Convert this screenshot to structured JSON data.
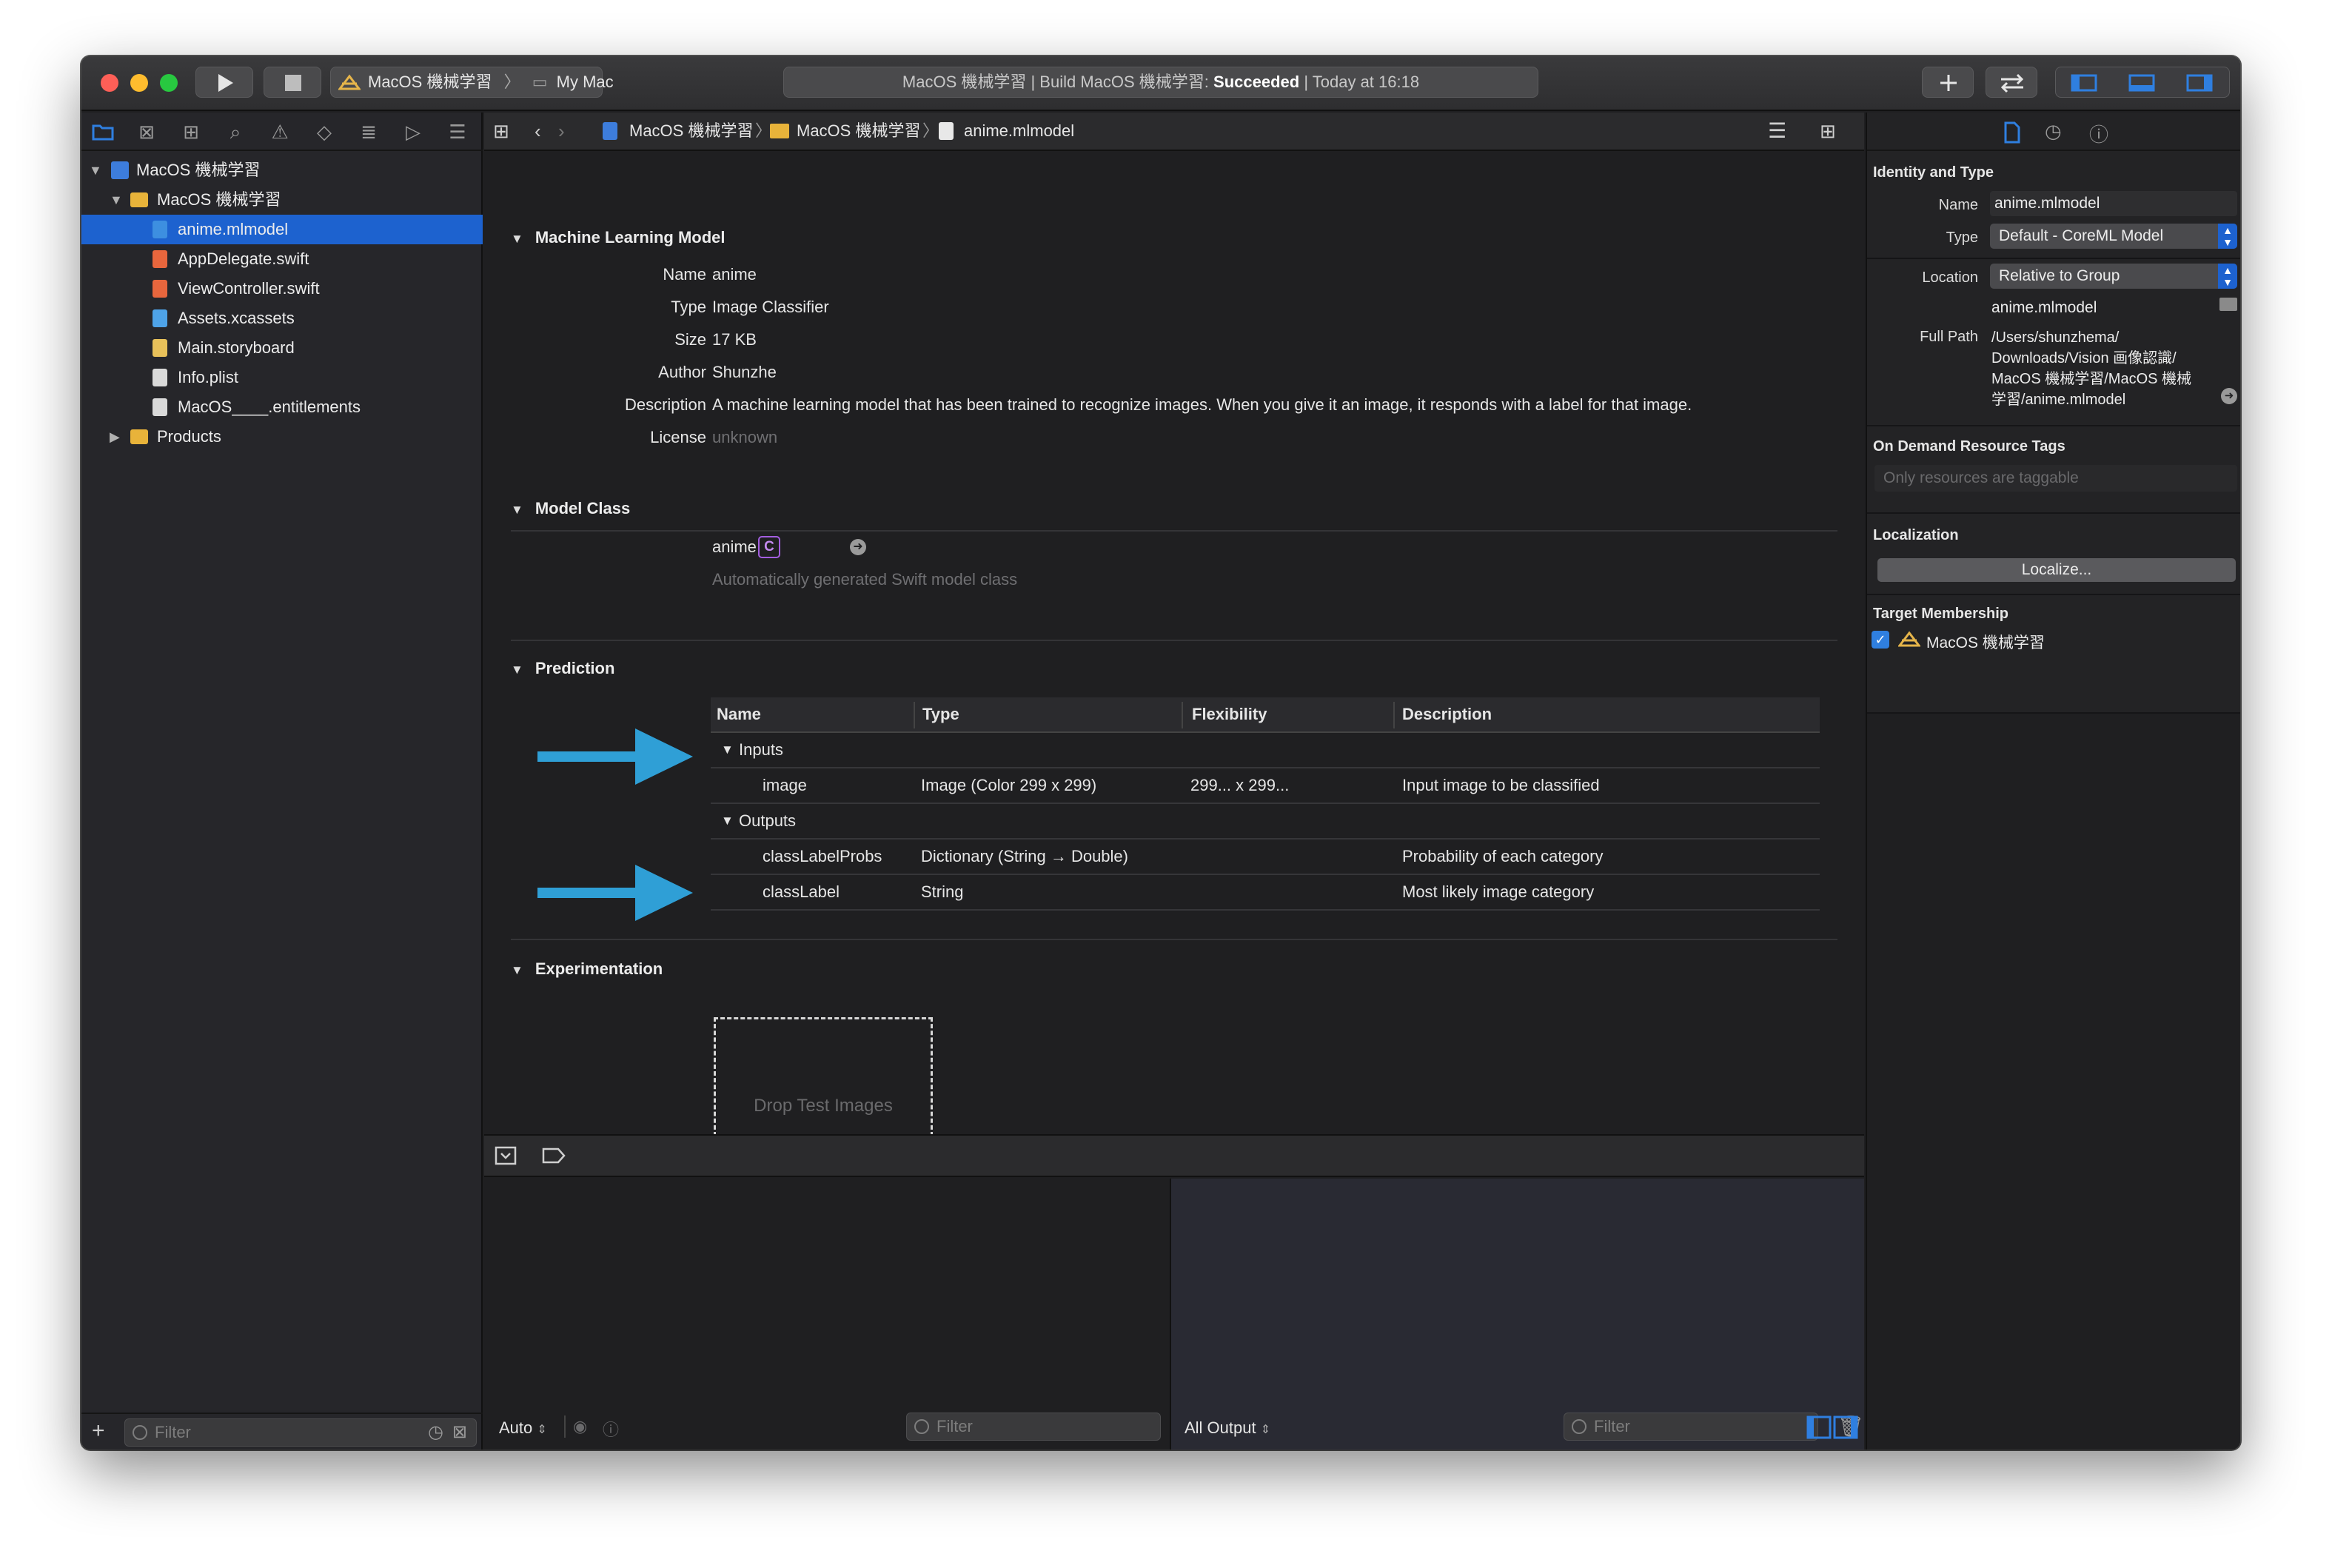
{
  "toolbar": {
    "scheme_target": "MacOS 機械学習",
    "scheme_device": "My Mac",
    "activity_prefix": "MacOS 機械学習 | Build MacOS 機械学習: ",
    "activity_status": "Succeeded",
    "activity_time": " | Today at 16:18"
  },
  "navigator": {
    "project": "MacOS 機械学習",
    "group": "MacOS 機械学習",
    "files": [
      {
        "name": "anime.mlmodel",
        "icon": "mlmodel-file-icon",
        "color": "#3d8fe0"
      },
      {
        "name": "AppDelegate.swift",
        "icon": "swift-file-icon",
        "color": "#e8663d"
      },
      {
        "name": "ViewController.swift",
        "icon": "swift-file-icon",
        "color": "#e8663d"
      },
      {
        "name": "Assets.xcassets",
        "icon": "asset-catalog-icon",
        "color": "#4ea3e8"
      },
      {
        "name": "Main.storyboard",
        "icon": "storyboard-file-icon",
        "color": "#e8c15a"
      },
      {
        "name": "Info.plist",
        "icon": "plist-file-icon",
        "color": "#d9d9d9"
      },
      {
        "name": "MacOS____.entitlements",
        "icon": "entitlements-file-icon",
        "color": "#d9d9d9"
      }
    ],
    "products": "Products",
    "filter_placeholder": "Filter"
  },
  "jumpbar": {
    "crumb1": "MacOS 機械学習",
    "crumb2": "MacOS 機械学習",
    "crumb3": "anime.mlmodel"
  },
  "model": {
    "section_title": "Machine Learning Model",
    "fields": [
      {
        "label": "Name",
        "value": "anime"
      },
      {
        "label": "Type",
        "value": "Image Classifier"
      },
      {
        "label": "Size",
        "value": "17 KB"
      },
      {
        "label": "Author",
        "value": "Shunzhe"
      },
      {
        "label": "Description",
        "value": "A machine learning model that has been trained to recognize images. When you give it an image, it responds with a label for that image."
      },
      {
        "label": "License",
        "value": "unknown"
      }
    ]
  },
  "model_class": {
    "section_title": "Model Class",
    "badge": "C",
    "name": "anime",
    "note": "Automatically generated Swift model class"
  },
  "prediction": {
    "section_title": "Prediction",
    "headers": [
      "Name",
      "Type",
      "Flexibility",
      "Description"
    ],
    "inputs_label": "Inputs",
    "outputs_label": "Outputs",
    "inputs": [
      {
        "name": "image",
        "type": "Image (Color 299 x 299)",
        "flexibility": "299... x 299...",
        "description": "Input image to be classified"
      }
    ],
    "outputs": [
      {
        "name": "classLabelProbs",
        "type": "Dictionary (String → Double)",
        "flexibility": "",
        "description": "Probability of each category"
      },
      {
        "name": "classLabel",
        "type": "String",
        "flexibility": "",
        "description": "Most likely image category"
      }
    ],
    "arrow_color": "#2f9fd6"
  },
  "experimentation": {
    "section_title": "Experimentation",
    "drop_label": "Drop Test Images"
  },
  "debug": {
    "auto_label": "Auto",
    "output_label": "All Output",
    "filter_placeholder": "Filter"
  },
  "inspector": {
    "identity_title": "Identity and Type",
    "name_label": "Name",
    "name_value": "anime.mlmodel",
    "type_label": "Type",
    "type_value": "Default - CoreML Model",
    "location_label": "Location",
    "location_value": "Relative to Group",
    "file_name": "anime.mlmodel",
    "fullpath_label": "Full Path",
    "fullpath_lines": [
      "/Users/shunzhema/",
      "Downloads/Vision 画像認識/",
      "MacOS 機械学習/MacOS 機械",
      "学習/anime.mlmodel"
    ],
    "odr_title": "On Demand Resource Tags",
    "odr_placeholder": "Only resources are taggable",
    "localization_title": "Localization",
    "localize_button": "Localize...",
    "target_title": "Target Membership",
    "target_name": "MacOS 機械学習",
    "target_checked": true
  },
  "colors": {
    "selection": "#1d62cf",
    "accent": "#2f7fe0"
  }
}
